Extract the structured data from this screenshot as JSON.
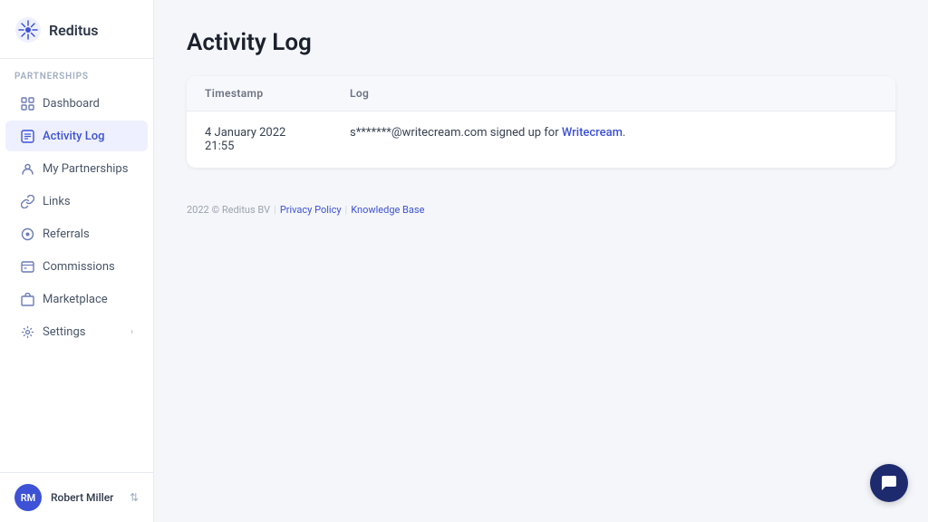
{
  "app": {
    "name": "Reditus"
  },
  "sidebar": {
    "section_label": "Partnerships",
    "items": [
      {
        "id": "dashboard",
        "label": "Dashboard",
        "active": false
      },
      {
        "id": "activity-log",
        "label": "Activity Log",
        "active": true
      },
      {
        "id": "my-partnerships",
        "label": "My Partnerships",
        "active": false
      },
      {
        "id": "links",
        "label": "Links",
        "active": false
      },
      {
        "id": "referrals",
        "label": "Referrals",
        "active": false
      },
      {
        "id": "commissions",
        "label": "Commissions",
        "active": false
      },
      {
        "id": "marketplace",
        "label": "Marketplace",
        "active": false
      },
      {
        "id": "settings",
        "label": "Settings",
        "active": false,
        "has_chevron": true
      }
    ],
    "user": {
      "name": "Robert Miller",
      "initials": "RM"
    }
  },
  "main": {
    "page_title": "Activity Log",
    "table": {
      "columns": [
        {
          "id": "timestamp",
          "label": "Timestamp"
        },
        {
          "id": "log",
          "label": "Log"
        }
      ],
      "rows": [
        {
          "timestamp": "4 January 2022 21:55",
          "log_text": "s*******@writecream.com signed up for ",
          "log_link_text": "Writecream",
          "log_suffix": "."
        }
      ]
    }
  },
  "footer": {
    "copyright": "2022 © Reditus BV",
    "privacy_label": "Privacy Policy",
    "knowledge_base_label": "Knowledge Base"
  },
  "chat": {
    "label": "Chat"
  }
}
